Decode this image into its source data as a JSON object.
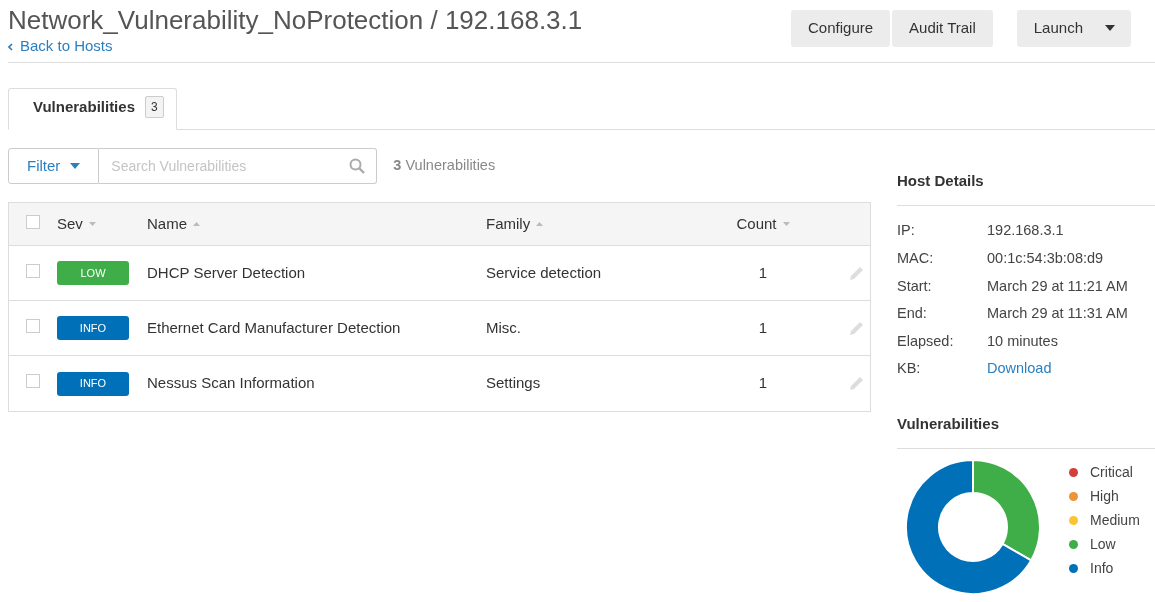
{
  "header": {
    "title": "Network_Vulnerability_NoProtection / 192.168.3.1",
    "back_link": "Back to Hosts",
    "buttons": [
      "Configure",
      "Audit Trail"
    ],
    "launch_button": "Launch"
  },
  "tabs": [
    {
      "label": "Vulnerabilities",
      "count": "3",
      "selected": true
    }
  ],
  "toolbar": {
    "filter_button": "Filter",
    "search": {
      "placeholder": "Search Vulnerabilities"
    },
    "result_count": "3",
    "result_label": "Vulnerabilities"
  },
  "table": {
    "header_checked": false,
    "columns": [
      {
        "label": "Sev",
        "sort_ascending": false
      },
      {
        "label": "Name",
        "sort_ascending": true
      },
      {
        "label": "Family",
        "sort_ascending": true
      },
      {
        "label": "Count",
        "sort_ascending": false
      }
    ],
    "rows": [
      {
        "checked": false,
        "severity": "LOW",
        "color": "#3fae49",
        "name": "DHCP Server Detection",
        "family": "Service detection",
        "count": "1"
      },
      {
        "checked": false,
        "severity": "INFO",
        "color": "#0071b9",
        "name": "Ethernet Card Manufacturer Detection",
        "family": "Misc.",
        "count": "1"
      },
      {
        "checked": false,
        "severity": "INFO",
        "color": "#0071b9",
        "name": "Nessus Scan Information",
        "family": "Settings",
        "count": "1"
      }
    ]
  },
  "host_details": {
    "title": "Host Details",
    "fields": [
      {
        "label": "IP:",
        "value": "192.168.3.1"
      },
      {
        "label": "MAC:",
        "value": "00:1c:54:3b:08:d9"
      },
      {
        "label": "Start:",
        "value": "March 29 at 11:21 AM"
      },
      {
        "label": "End:",
        "value": "March 29 at 11:31 AM"
      },
      {
        "label": "Elapsed:",
        "value": "10 minutes"
      },
      {
        "label": "KB:",
        "value": "Download",
        "kind": "link"
      }
    ]
  },
  "vulnerabilities_panel": {
    "title": "Vulnerabilities",
    "legend": [
      {
        "color": "#d43f3a"
      },
      {
        "color": "#ee9336"
      },
      {
        "color": "#fdc431"
      },
      {
        "color": "#3fae49"
      },
      {
        "color": "#0071b9"
      }
    ],
    "chart_data": {
      "type": "donut",
      "categories": [
        "Critical",
        "High",
        "Medium",
        "Low",
        "Info"
      ],
      "values": [
        0,
        0,
        0,
        33.3,
        66.7
      ]
    }
  }
}
